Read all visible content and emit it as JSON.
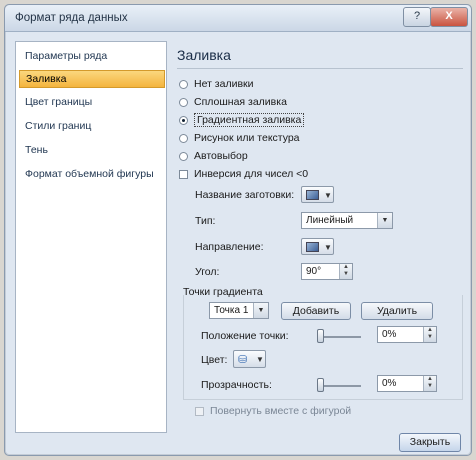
{
  "window": {
    "title": "Формат ряда данных",
    "help_label": "?",
    "close_label": "X"
  },
  "sidebar": {
    "items": [
      {
        "label": "Параметры ряда"
      },
      {
        "label": "Заливка"
      },
      {
        "label": "Цвет границы"
      },
      {
        "label": "Стили границ"
      },
      {
        "label": "Тень"
      },
      {
        "label": "Формат объемной фигуры"
      }
    ],
    "selected": "Заливка"
  },
  "fill": {
    "title": "Заливка",
    "options": [
      {
        "label": "Нет заливки",
        "checked": false
      },
      {
        "label": "Сплошная заливка",
        "checked": false
      },
      {
        "label": "Градиентная заливка",
        "checked": true
      },
      {
        "label": "Рисунок или текстура",
        "checked": false
      },
      {
        "label": "Автовыбор",
        "checked": false
      }
    ],
    "invert_label": "Инверсия для чисел <0",
    "preset_label": "Название заготовки:",
    "type_label": "Тип:",
    "type_value": "Линейный",
    "direction_label": "Направление:",
    "angle_label": "Угол:",
    "angle_value": "90°",
    "stops_title": "Точки градиента",
    "stop_value": "Точка 1",
    "add_label": "Добавить",
    "remove_label": "Удалить",
    "position_label": "Положение точки:",
    "position_value": "0%",
    "color_label": "Цвет:",
    "transparency_label": "Прозрачность:",
    "transparency_value": "0%",
    "rotate_label": "Повернуть вместе с фигурой"
  },
  "footer": {
    "close_label": "Закрыть"
  },
  "icons": {
    "swatch": "gradient-swatch-icon",
    "bucket": "paint-bucket-icon",
    "dropdown": "chevron-down-icon"
  }
}
